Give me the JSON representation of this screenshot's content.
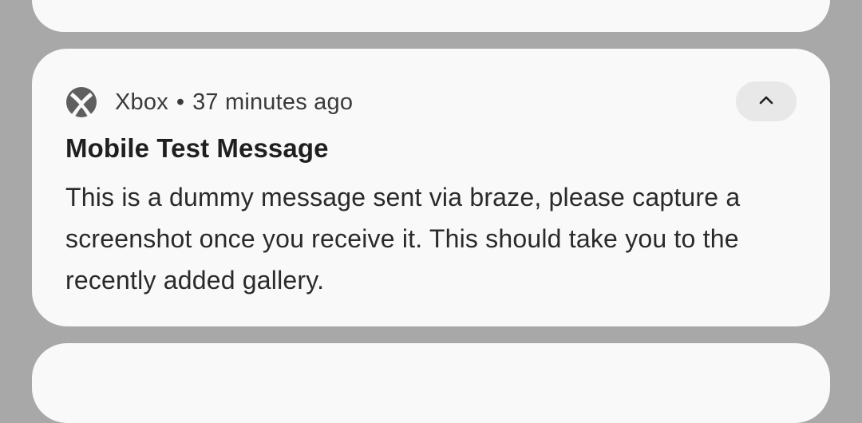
{
  "notification": {
    "app_name": "Xbox",
    "separator": "•",
    "time": "37 minutes ago",
    "app_icon": "xbox-logo-icon",
    "collapse_icon": "chevron-up-icon",
    "title": "Mobile Test Message",
    "body": "This is a dummy message sent via braze, please capture a screenshot once you receive it. This should take you to the recently added gallery."
  },
  "colors": {
    "background": "#a8a8a8",
    "card": "#f9f9f9",
    "button": "#e8e8e8",
    "icon": "#555555"
  }
}
